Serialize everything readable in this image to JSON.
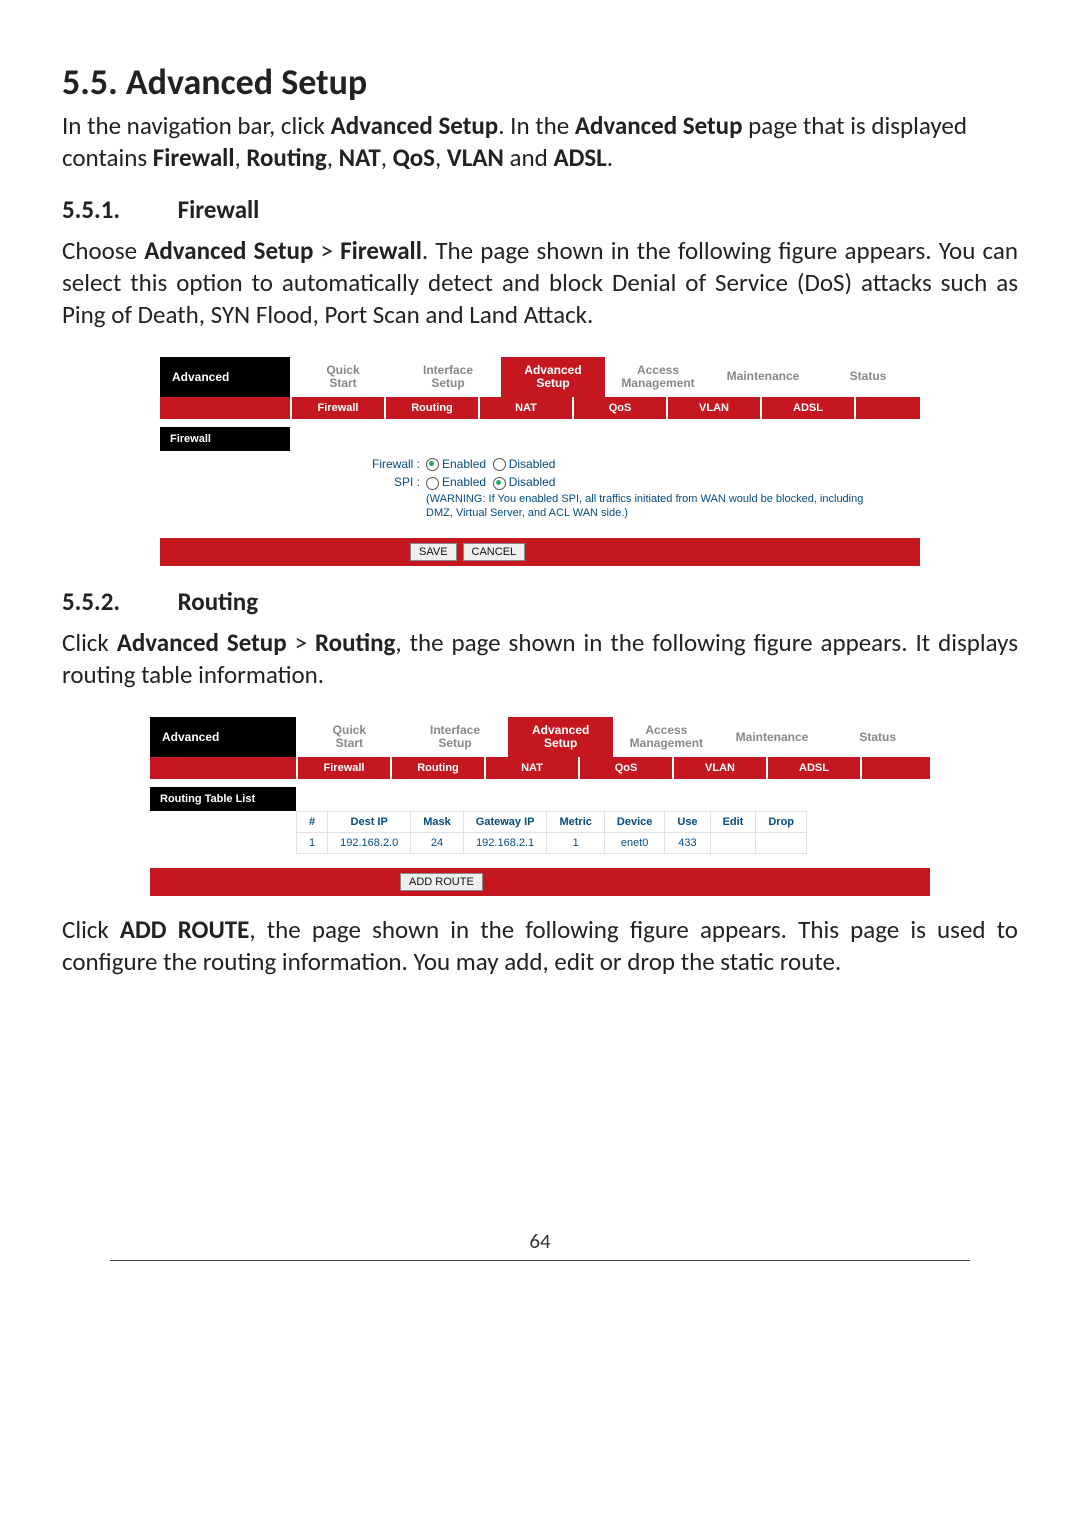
{
  "headings": {
    "h55": "5.5. Advanced Setup",
    "h551_num": "5.5.1.",
    "h551_title": "Firewall",
    "h552_num": "5.5.2.",
    "h552_title": "Routing"
  },
  "paragraphs": {
    "p1a": "In the navigation bar, click ",
    "p1b": "Advanced Setup",
    "p1c": ". In the ",
    "p1d": "Advanced Setup",
    "p1e": " page that is displayed contains ",
    "p1f": "Firewall",
    "p1g": ", ",
    "p1h": "Routing",
    "p1i": ", ",
    "p1j": "NAT",
    "p1k": ", ",
    "p1l": "QoS",
    "p1m": ", ",
    "p1n": "VLAN",
    "p1o": " and ",
    "p1p": "ADSL",
    "p1q": ".",
    "p2a": "Choose ",
    "p2b": "Advanced Setup",
    "p2c": " > ",
    "p2d": "Firewall",
    "p2e": ". The page shown in the following figure appears. You can select this option to automatically detect and block Denial of Service (DoS) attacks such as Ping of Death, SYN Flood, Port Scan and Land Attack.",
    "p3a": "Click ",
    "p3b": "Advanced Setup",
    "p3c": " > ",
    "p3d": "Routing",
    "p3e": ", the page shown in the following figure appears. It displays routing table information.",
    "p4a": "Click ",
    "p4b": "ADD ROUTE",
    "p4c": ", the page shown in the following figure appears. This page is used to configure the routing information. You may add, edit or drop the static route."
  },
  "shot1": {
    "panel_title": "Advanced",
    "main_tabs": {
      "t1a": "Quick",
      "t1b": "Start",
      "t2a": "Interface",
      "t2b": "Setup",
      "t3a": "Advanced",
      "t3b": "Setup",
      "t4a": "Access",
      "t4b": "Management",
      "t5": "Maintenance",
      "t6": "Status"
    },
    "sub_tabs": {
      "s1": "Firewall",
      "s2": "Routing",
      "s3": "NAT",
      "s4": "QoS",
      "s5": "VLAN",
      "s6": "ADSL"
    },
    "section_label": "Firewall",
    "form": {
      "row1_label": "Firewall :",
      "row1_opt1": "Enabled",
      "row1_opt2": "Disabled",
      "row2_label": "SPI :",
      "row2_opt1": "Enabled",
      "row2_opt2": "Disabled",
      "note1": "(WARNING: If You enabled SPI, all traffics initiated from WAN would be blocked, including",
      "note2": "DMZ, Virtual Server, and ACL WAN side.)"
    },
    "buttons": {
      "save": "SAVE",
      "cancel": "CANCEL"
    }
  },
  "shot2": {
    "panel_title": "Advanced",
    "main_tabs": {
      "t1a": "Quick",
      "t1b": "Start",
      "t2a": "Interface",
      "t2b": "Setup",
      "t3a": "Advanced",
      "t3b": "Setup",
      "t4a": "Access",
      "t4b": "Management",
      "t5": "Maintenance",
      "t6": "Status"
    },
    "sub_tabs": {
      "s1": "Firewall",
      "s2": "Routing",
      "s3": "NAT",
      "s4": "QoS",
      "s5": "VLAN",
      "s6": "ADSL"
    },
    "section_label": "Routing Table List",
    "table": {
      "headers": {
        "c1": "#",
        "c2": "Dest IP",
        "c3": "Mask",
        "c4": "Gateway IP",
        "c5": "Metric",
        "c6": "Device",
        "c7": "Use",
        "c8": "Edit",
        "c9": "Drop"
      },
      "row1": {
        "c1": "1",
        "c2": "192.168.2.0",
        "c3": "24",
        "c4": "192.168.2.1",
        "c5": "1",
        "c6": "enet0",
        "c7": "433",
        "c8": "",
        "c9": ""
      }
    },
    "buttons": {
      "add": "ADD ROUTE"
    }
  },
  "footer": {
    "page_number": "64"
  }
}
